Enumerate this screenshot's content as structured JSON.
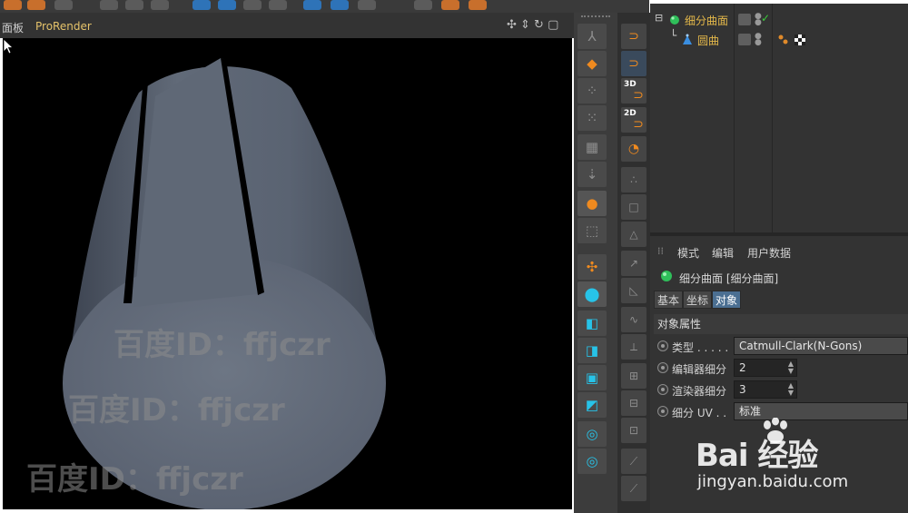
{
  "viewport": {
    "menu_left": "面板",
    "menu_prorender": "ProRender",
    "nav_glyphs": "✣ ⇕ ↻ ▢"
  },
  "watermark": {
    "text": "百度ID：ffjczr",
    "brand": "Bai 经验",
    "site": "jingyan.baidu.com"
  },
  "object_manager": {
    "objects": [
      {
        "name": "细分曲面",
        "icon": "subdivision-surface-icon",
        "color": "#e4b84a"
      },
      {
        "name": "圆曲",
        "icon": "cylinder-icon",
        "color": "#e4b84a"
      }
    ]
  },
  "attribute_manager": {
    "menu": [
      "模式",
      "编辑",
      "用户数据"
    ],
    "title": "细分曲面 [细分曲面]",
    "tabs": [
      {
        "label": "基本",
        "active": false
      },
      {
        "label": "坐标",
        "active": false
      },
      {
        "label": "对象",
        "active": true
      }
    ],
    "section": "对象属性",
    "properties": [
      {
        "label": "类型 . . . . .",
        "value": "Catmull-Clark(N-Gons)",
        "kind": "select"
      },
      {
        "label": "编辑器细分",
        "value": "2",
        "kind": "number"
      },
      {
        "label": "渲染器细分",
        "value": "3",
        "kind": "number"
      },
      {
        "label": "细分 UV . .",
        "value": "标准",
        "kind": "select"
      }
    ]
  },
  "toolbar2_labels": {
    "three_d": "3D",
    "two_d": "2D"
  },
  "colors": {
    "accent_orange": "#ef8a1f",
    "accent_cyan": "#27c3e8",
    "active_tab": "#4b6f92"
  }
}
